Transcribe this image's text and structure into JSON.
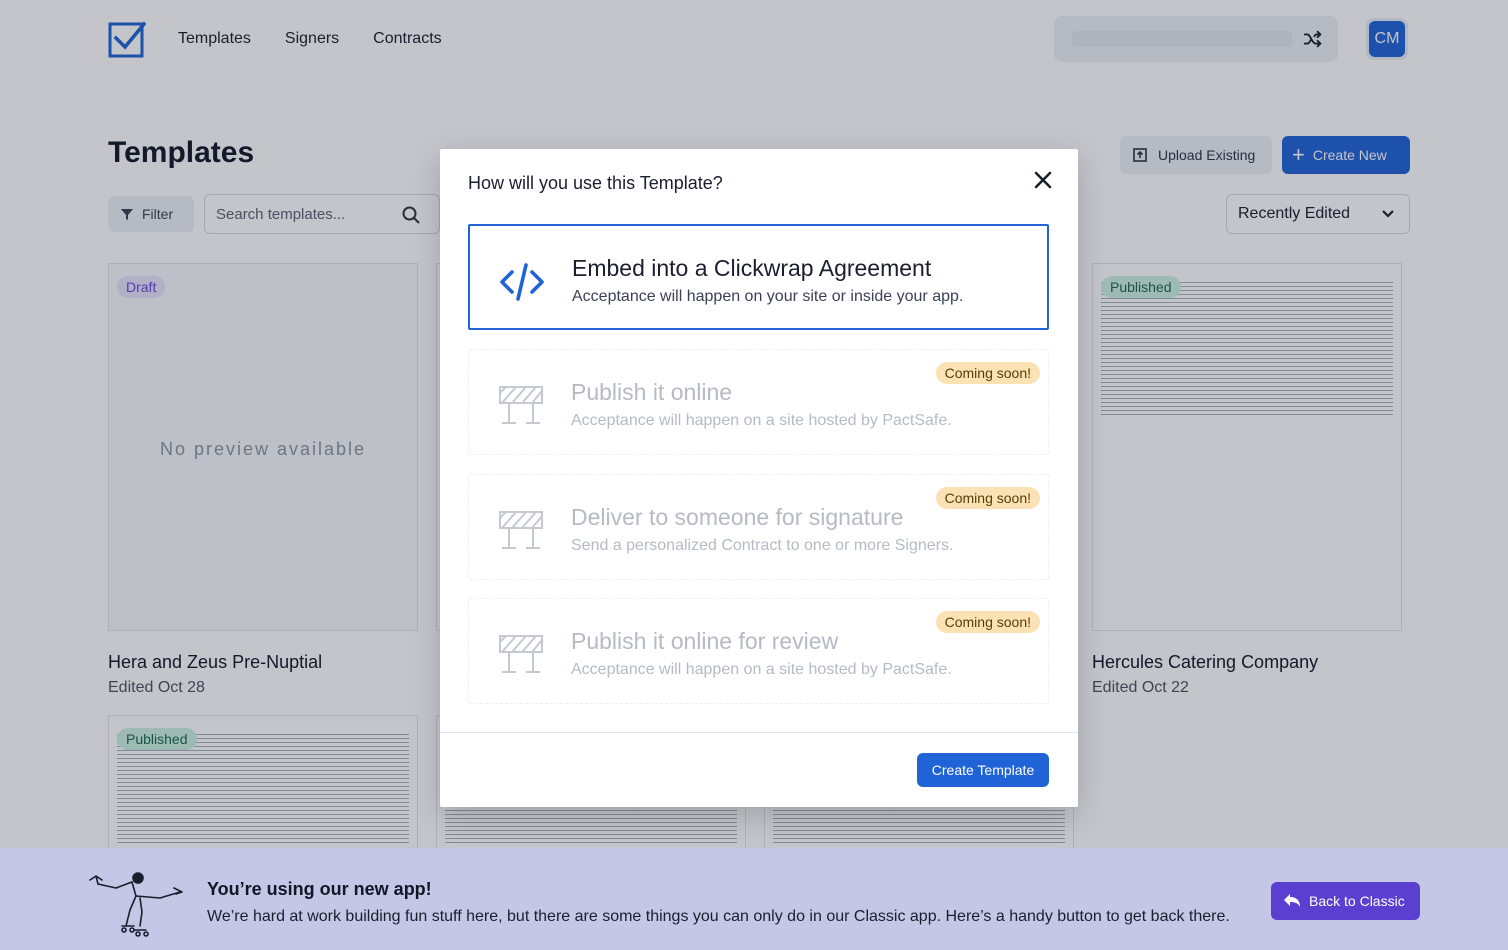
{
  "nav": {
    "items": [
      "Templates",
      "Signers",
      "Contracts"
    ],
    "avatar_initials": "CM"
  },
  "page": {
    "title": "Templates",
    "upload_label": "Upload Existing",
    "create_label": "Create New",
    "filter_label": "Filter",
    "search_placeholder": "Search templates...",
    "sort_value": "Recently Edited"
  },
  "cards": [
    {
      "status": "Draft",
      "title": "Hera and Zeus Pre-Nuptial",
      "edited": "Edited Oct 28",
      "preview_text": "No preview available"
    },
    {
      "status": "Published",
      "title": "Hercules Catering Company",
      "edited": "Edited Oct 22"
    },
    {
      "status": "Published"
    }
  ],
  "modal": {
    "title": "How will you use this Template?",
    "options": [
      {
        "title": "Embed into a Clickwrap Agreement",
        "desc": "Acceptance will happen on your site or inside your app.",
        "icon": "code-icon"
      },
      {
        "title": "Publish it online",
        "desc": "Acceptance will happen on a site hosted by PactSafe.",
        "badge": "Coming soon!",
        "icon": "barrier-icon"
      },
      {
        "title": "Deliver to someone for signature",
        "desc": "Send a personalized Contract to one or more Signers.",
        "badge": "Coming soon!",
        "icon": "barrier-icon"
      },
      {
        "title": "Publish it online for review",
        "desc": "Acceptance will happen on a site hosted by PactSafe.",
        "badge": "Coming soon!",
        "icon": "barrier-icon"
      }
    ],
    "submit_label": "Create Template"
  },
  "banner": {
    "title": "You’re using our new app!",
    "text": "We’re hard at work building fun stuff here, but there are some things you can only do in our Classic app. Here’s a handy button to get back there.",
    "button_label": "Back to Classic"
  },
  "colors": {
    "primary": "#1f63d6",
    "classic_button": "#5b3fd0",
    "banner_bg": "#c6c6e6",
    "draft_badge": "#e8e3fb",
    "published_badge": "#ccf0e1",
    "coming_soon_badge": "#fbe2b5"
  }
}
